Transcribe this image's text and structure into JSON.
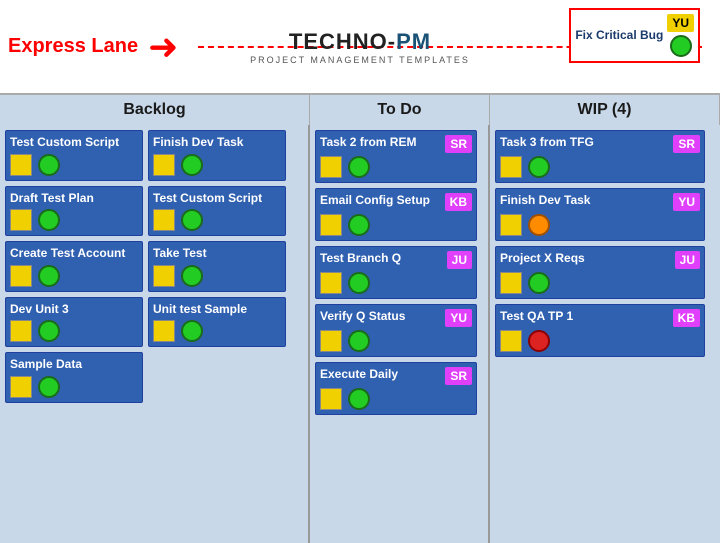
{
  "header": {
    "express_lane": "Express Lane",
    "logo_part1": "TECHNO-",
    "logo_part2": "PM",
    "logo_sub": "PROJECT MANAGEMENT TEMPLATES",
    "express_card": {
      "title": "Fix Critical Bug",
      "badge": "YU",
      "badge_color": "yellow"
    }
  },
  "columns": {
    "backlog": {
      "label": "Backlog",
      "cards": [
        {
          "title": "Test Custom Script",
          "badge": null,
          "dot": "green"
        },
        {
          "title": "Finish Dev Task",
          "badge": null,
          "dot": "green"
        },
        {
          "title": "Draft Test Plan",
          "badge": null,
          "dot": "green"
        },
        {
          "title": "Test Custom Script",
          "badge": null,
          "dot": "green"
        },
        {
          "title": "Create Test Account",
          "badge": null,
          "dot": "green"
        },
        {
          "title": "Take Test",
          "badge": null,
          "dot": "green"
        },
        {
          "title": "Dev Unit 3",
          "badge": null,
          "dot": "green"
        },
        {
          "title": "Unit test Sample",
          "badge": null,
          "dot": "green"
        },
        {
          "title": "Sample Data",
          "badge": null,
          "dot": "green"
        }
      ]
    },
    "todo": {
      "label": "To Do",
      "cards": [
        {
          "title": "Task 2 from REM",
          "badge": "SR",
          "dot": "green"
        },
        {
          "title": "Email Config Setup",
          "badge": "KB",
          "dot": "green"
        },
        {
          "title": "Test Branch Q",
          "badge": "JU",
          "dot": "green"
        },
        {
          "title": "Verify Q Status",
          "badge": "YU",
          "dot": "green"
        },
        {
          "title": "Execute Daily",
          "badge": "SR",
          "dot": "green"
        }
      ]
    },
    "wip": {
      "label": "WIP (4)",
      "cards": [
        {
          "title": "Task 3 from TFG",
          "badge": "SR",
          "dot": "green"
        },
        {
          "title": "Finish Dev Task",
          "badge": "YU",
          "dot": "orange"
        },
        {
          "title": "Project X Reqs",
          "badge": "JU",
          "dot": "green"
        },
        {
          "title": "Test QA TP 1",
          "badge": "KB",
          "dot": "red"
        }
      ]
    }
  }
}
